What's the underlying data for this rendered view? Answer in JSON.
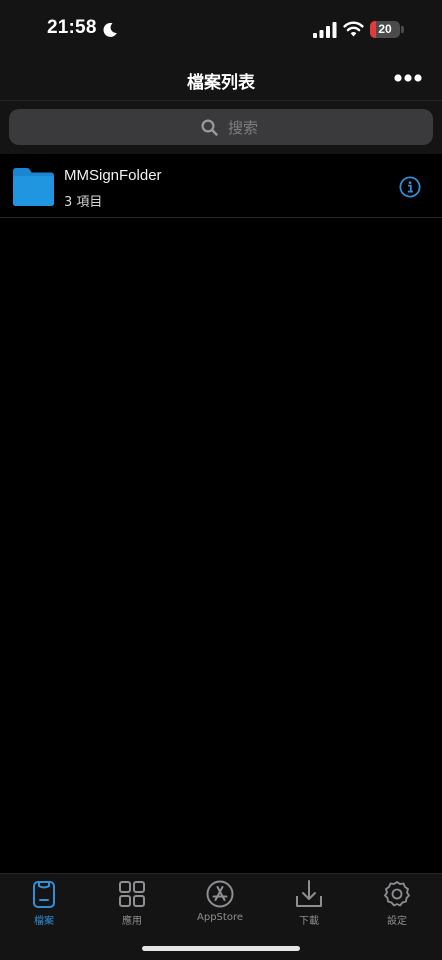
{
  "status_bar": {
    "time": "21:58",
    "battery_level": "20",
    "battery_fraction": 0.2,
    "icons": [
      "moon-icon",
      "signal-icon",
      "wifi-icon",
      "battery-icon"
    ]
  },
  "header": {
    "title": "檔案列表",
    "more_icon": "ellipsis-icon"
  },
  "search": {
    "placeholder": "搜索"
  },
  "files": [
    {
      "name": "MMSignFolder",
      "count": "3 項目",
      "icon": "folder-icon"
    }
  ],
  "tabs": [
    {
      "label": "檔案",
      "icon": "files-icon",
      "active": true
    },
    {
      "label": "應用",
      "icon": "apps-grid-icon",
      "active": false
    },
    {
      "label": "AppStore",
      "icon": "appstore-icon",
      "active": false
    },
    {
      "label": "下載",
      "icon": "download-icon",
      "active": false
    },
    {
      "label": "設定",
      "icon": "gear-icon",
      "active": false
    }
  ],
  "colors": {
    "accent": "#2f8fd8",
    "folder": "#2196e0",
    "battery_low": "#e23b3b",
    "tab_inactive": "#8e8e93"
  }
}
